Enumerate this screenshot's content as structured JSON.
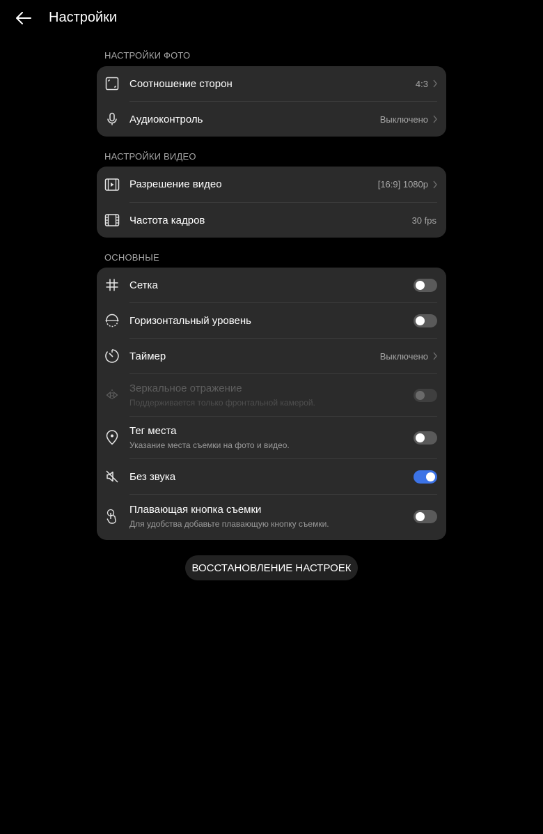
{
  "header": {
    "title": "Настройки"
  },
  "sections": {
    "photo": {
      "title": "НАСТРОЙКИ ФОТО",
      "items": [
        {
          "label": "Соотношение сторон",
          "value": "4:3"
        },
        {
          "label": "Аудиоконтроль",
          "value": "Выключено"
        }
      ]
    },
    "video": {
      "title": "НАСТРОЙКИ ВИДЕО",
      "items": [
        {
          "label": "Разрешение видео",
          "value": "[16:9] 1080p"
        },
        {
          "label": "Частота кадров",
          "value": "30 fps"
        }
      ]
    },
    "general": {
      "title": "ОСНОВНЫЕ",
      "items": [
        {
          "label": "Сетка",
          "enabled": false
        },
        {
          "label": "Горизонтальный уровень",
          "enabled": false
        },
        {
          "label": "Таймер",
          "value": "Выключено"
        },
        {
          "label": "Зеркальное отражение",
          "sub": "Поддерживается только фронтальной камерой.",
          "enabled": false,
          "disabled": true
        },
        {
          "label": "Тег места",
          "sub": "Указание места съемки на фото и видео.",
          "enabled": false
        },
        {
          "label": "Без звука",
          "enabled": true
        },
        {
          "label": "Плавающая кнопка съемки",
          "sub": "Для удобства добавьте плавающую кнопку съемки.",
          "enabled": false
        }
      ]
    }
  },
  "reset_button": {
    "label": "ВОССТАНОВЛЕНИЕ НАСТРОЕК"
  },
  "colors": {
    "background": "#000000",
    "card": "#2b2b2b",
    "accent": "#3c73e6",
    "secondary_text": "#a6a6a6"
  }
}
